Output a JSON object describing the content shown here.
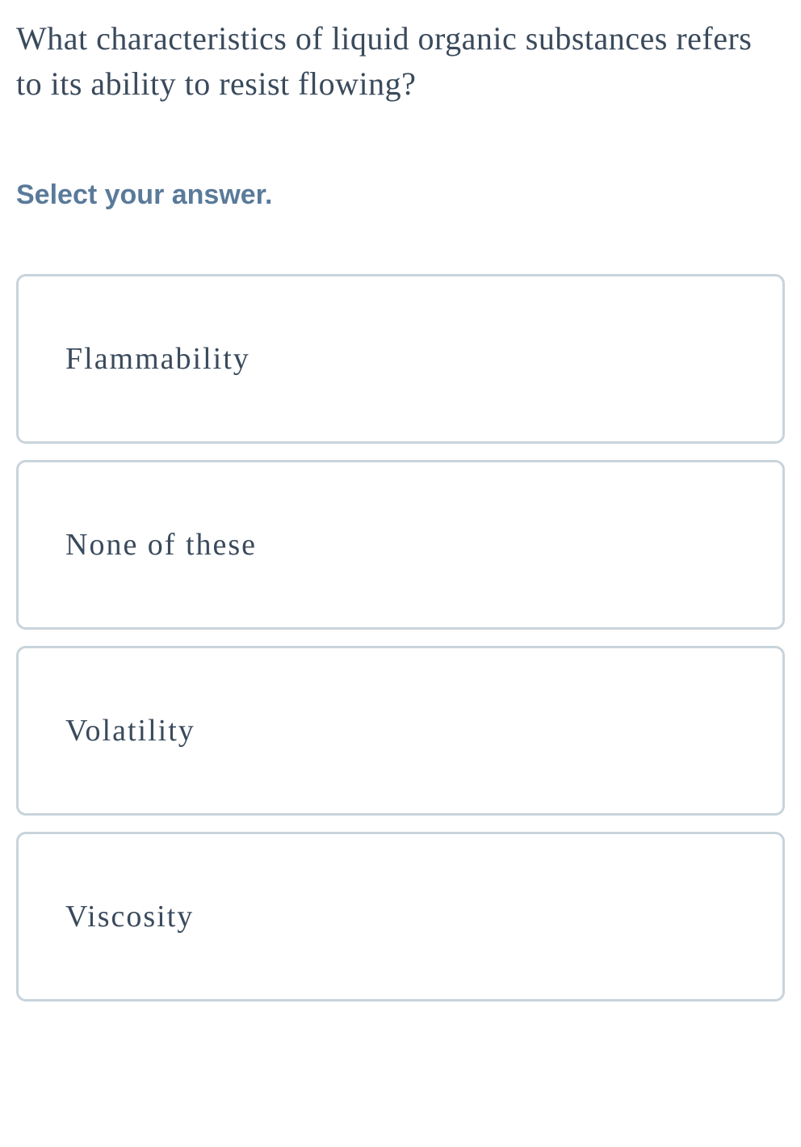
{
  "question": "What characteristics of liquid organic substances refers to its ability to resist flowing?",
  "instruction": "Select your answer.",
  "options": [
    {
      "label": "Flammability"
    },
    {
      "label": "None of these"
    },
    {
      "label": "Volatility"
    },
    {
      "label": "Viscosity"
    }
  ]
}
